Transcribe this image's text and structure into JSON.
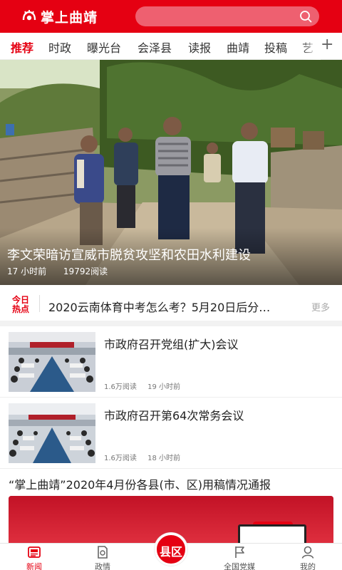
{
  "app": {
    "logo_text": "掌上曲靖",
    "accent": "#e50012"
  },
  "search": {
    "icon": "search-icon"
  },
  "tabs": [
    {
      "label": "推荐",
      "active": true
    },
    {
      "label": "时政"
    },
    {
      "label": "曝光台"
    },
    {
      "label": "会泽县"
    },
    {
      "label": "读报"
    },
    {
      "label": "曲靖"
    },
    {
      "label": "投稿"
    },
    {
      "label": "艺"
    }
  ],
  "tabs_add_label": "+",
  "hero": {
    "title": "李文荣暗访宣威市脱贫攻坚和农田水利建设",
    "time": "17 小时前",
    "reads": "19792阅读"
  },
  "hot": {
    "badge_line1": "今日",
    "badge_line2": "热点",
    "text": "2020云南体育中考怎么考？5月20日后分…",
    "more": "更多"
  },
  "news": [
    {
      "title": "市政府召开党组(扩大)会议",
      "reads": "1.6万阅读",
      "time": "19 小时前"
    },
    {
      "title": "市政府召开第64次常务会议",
      "reads": "1.6万阅读",
      "time": "18 小时前"
    }
  ],
  "report": {
    "title": "“掌上曲靖”2020年4月份各县(市、区)用稿情况通报"
  },
  "bottom_nav": [
    {
      "label": "新闻",
      "icon": "newspaper-icon",
      "active": true
    },
    {
      "label": "政情",
      "icon": "document-icon"
    },
    {
      "label": "",
      "icon": "county-icon"
    },
    {
      "label": "全国党媒",
      "icon": "flag-icon"
    },
    {
      "label": "我的",
      "icon": "user-icon"
    }
  ],
  "center_button_label": "县区"
}
